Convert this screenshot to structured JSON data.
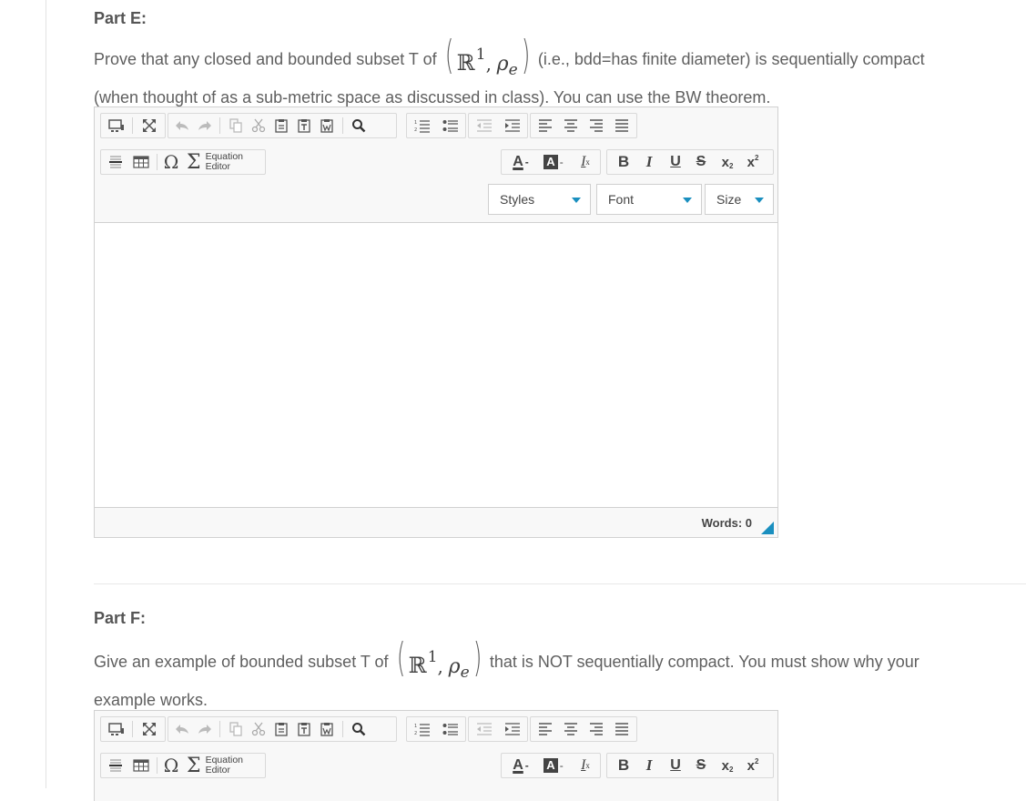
{
  "partE": {
    "title": "Part E:",
    "line1_before": "Prove that any closed and  bounded subset  T of",
    "line1_after": "(i.e., bdd=has finite diameter) is sequentially compact",
    "line2": "(when thought of as a sub-metric space as discussed in class). You can use the BW theorem.",
    "math_R": "ℝ",
    "math_sup": "1",
    "math_rho": "ρ",
    "math_sub": "e",
    "math_comma": ","
  },
  "partF": {
    "title": "Part F:",
    "line1_before": "Give an example of bounded subset  T of",
    "line1_after": "that is NOT sequentially compact. You must show why your",
    "line2": "example works.",
    "math_R": "ℝ",
    "math_sup": "1",
    "math_rho": "ρ",
    "math_sub": "e",
    "math_comma": ","
  },
  "editor": {
    "equation_label_1": "Equation",
    "equation_label_2": "Editor",
    "omega": "Ω",
    "sigma": "Σ",
    "font_color": "A",
    "bg_color": "A",
    "remove_format": "I",
    "bold": "B",
    "italic": "I",
    "underline": "U",
    "strike": "S",
    "subscript": "X",
    "superscript": "X",
    "styles_label": "Styles",
    "font_label": "Font",
    "size_label": "Size",
    "words_label": "Words: 0"
  },
  "colors": {
    "accent": "#1a8fbf",
    "text": "#5f5f5f",
    "border": "#d1d1d1"
  }
}
